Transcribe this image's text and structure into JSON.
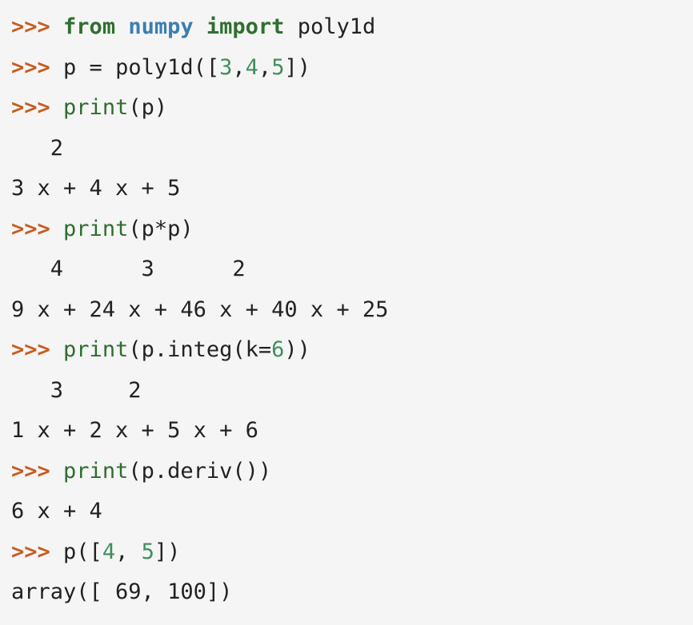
{
  "colors": {
    "background": "#f5f5f5",
    "prompt": "#c65d21",
    "keyword": "#2f6f2f",
    "module": "#3a7fb0",
    "function": "#2e6d2e",
    "number": "#3f8f5f",
    "text": "#222222"
  },
  "prompt": ">>>",
  "lines": {
    "l1": {
      "kw_from": "from",
      "module": "numpy",
      "kw_import": "import",
      "name": "poly1d"
    },
    "l2": {
      "lhs": "p = poly1d([",
      "n1": "3",
      "c1": ",",
      "n2": "4",
      "c2": ",",
      "n3": "5",
      "end": "])"
    },
    "l3": {
      "fn": "print",
      "args": "(p)"
    },
    "l4": "   2",
    "l5": "3 x + 4 x + 5",
    "l6": {
      "fn": "print",
      "args": "(p*p)"
    },
    "l7": "   4      3      2",
    "l8": "9 x + 24 x + 46 x + 40 x + 25",
    "l9": {
      "fn": "print",
      "args_start": "(p.integ(k=",
      "num": "6",
      "args_end": "))"
    },
    "l10": "   3     2",
    "l11": "1 x + 2 x + 5 x + 6",
    "l12": {
      "fn": "print",
      "args": "(p.deriv())"
    },
    "l13": "6 x + 4",
    "l14": {
      "start": "p([",
      "n1": "4",
      "sep": ", ",
      "n2": "5",
      "end": "])"
    },
    "l15": "array([ 69, 100])"
  }
}
